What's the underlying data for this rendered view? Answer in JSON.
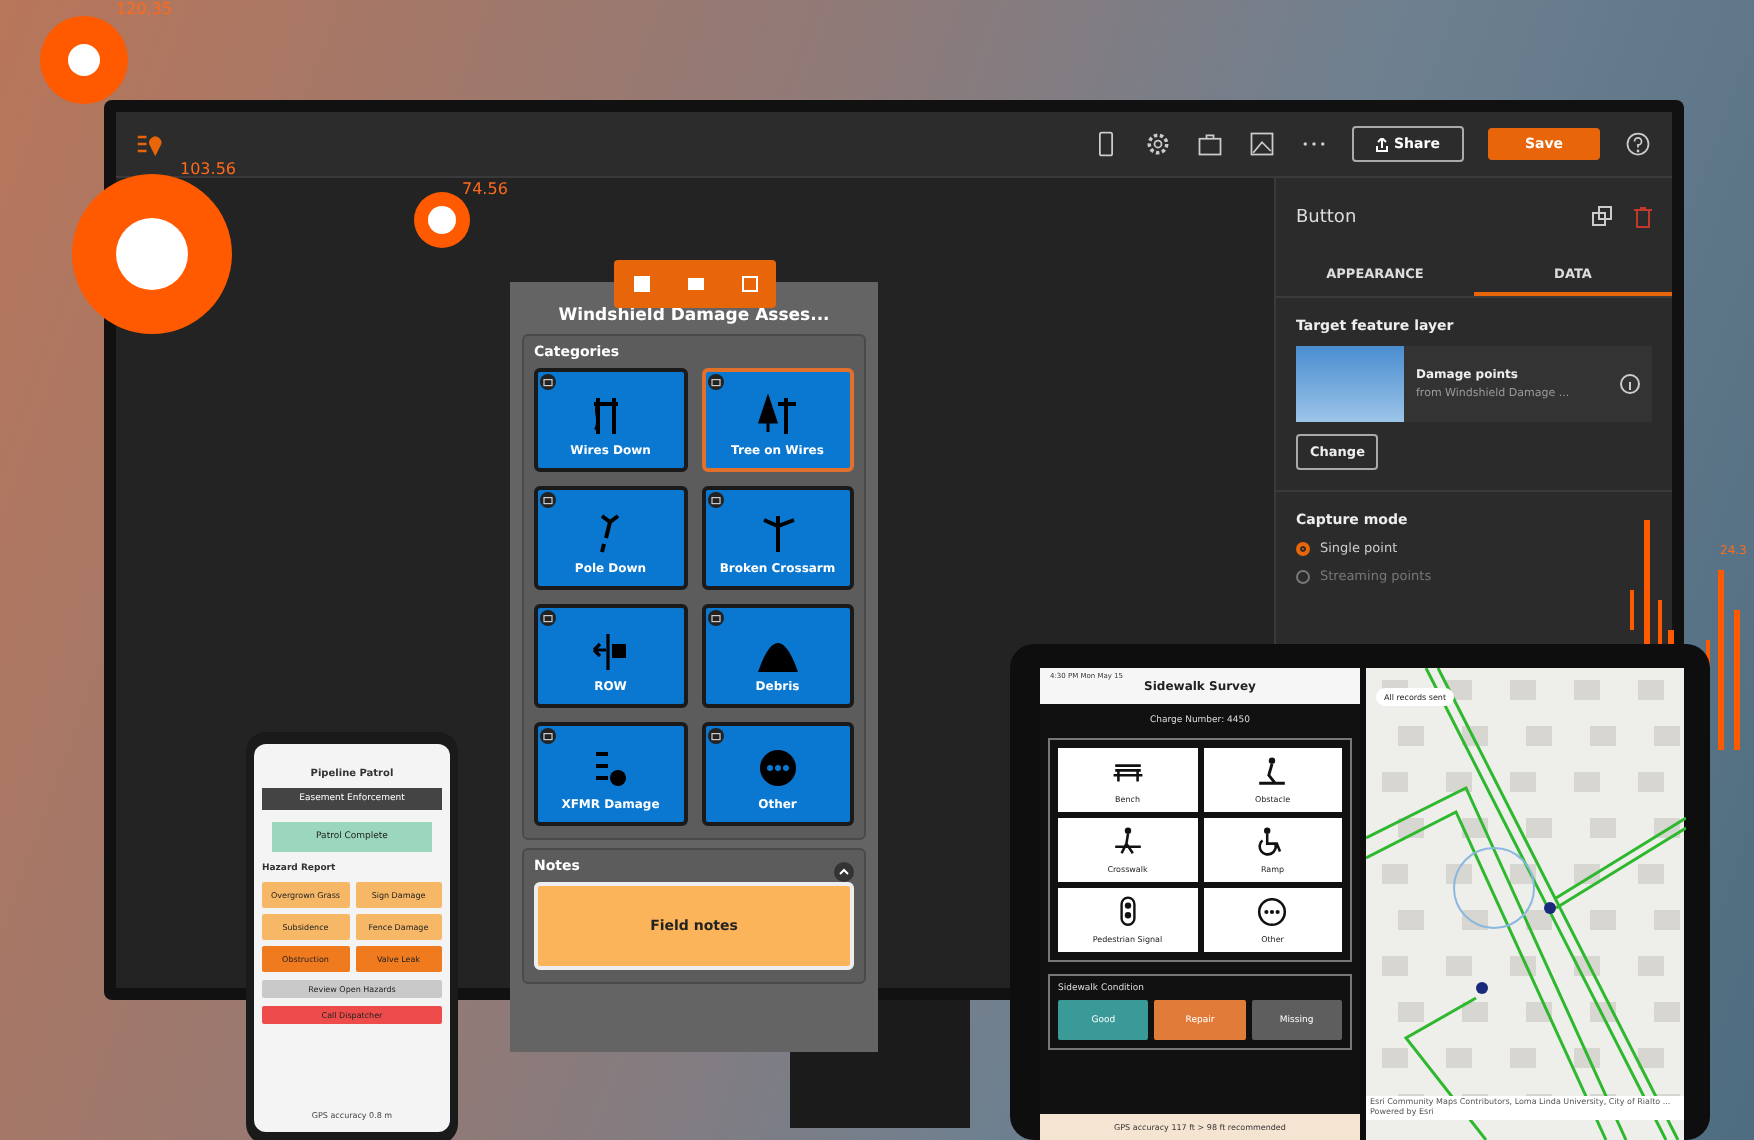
{
  "markers": [
    "120.35",
    "103.56",
    "74.56"
  ],
  "bar_label": "24.3",
  "builder": {
    "buttons": [
      {
        "label": "Share",
        "kind": "outline"
      },
      {
        "label": "Save",
        "kind": "primary"
      }
    ],
    "form": {
      "title": "Windshield Damage Asses...",
      "section": "Categories",
      "tiles": [
        {
          "label": "Wires Down",
          "selected": false
        },
        {
          "label": "Tree on Wires",
          "selected": true
        },
        {
          "label": "Pole Down",
          "selected": false
        },
        {
          "label": "Broken Crossarm",
          "selected": false
        },
        {
          "label": "ROW",
          "selected": false
        },
        {
          "label": "Debris",
          "selected": false
        },
        {
          "label": "XFMR Damage",
          "selected": false
        },
        {
          "label": "Other",
          "selected": false
        }
      ],
      "notes_label": "Notes",
      "notes_button": "Field notes"
    },
    "panel": {
      "title": "Button",
      "tabs": [
        {
          "label": "APPEARANCE",
          "selected": false
        },
        {
          "label": "DATA",
          "selected": true
        }
      ],
      "layer_heading": "Target feature layer",
      "layer_name": "Damage points",
      "layer_source": "from Windshield Damage ...",
      "change_button": "Change",
      "capture_heading": "Capture mode",
      "capture_options": [
        {
          "label": "Single point",
          "selected": true
        },
        {
          "label": "Streaming points",
          "selected": false
        }
      ]
    }
  },
  "phone": {
    "title": "Pipeline Patrol",
    "banner": "Easement Enforcement",
    "complete_button": "Patrol Complete",
    "section": "Hazard Report",
    "hazards": [
      {
        "label": "Overgrown Grass",
        "color": "#f6b867"
      },
      {
        "label": "Sign Damage",
        "color": "#f6b867"
      },
      {
        "label": "Subsidence",
        "color": "#f6b867"
      },
      {
        "label": "Fence Damage",
        "color": "#f6b867"
      },
      {
        "label": "Obstruction",
        "color": "#f07a1e"
      },
      {
        "label": "Valve Leak",
        "color": "#f07a1e"
      }
    ],
    "actions": [
      {
        "label": "Review Open Hazards",
        "color": "#c9c9c9"
      },
      {
        "label": "Call Dispatcher",
        "color": "#ee4b4b"
      }
    ],
    "status": "GPS accuracy 0.8 m"
  },
  "tablet": {
    "status_time": "4:30 PM  Mon May 15",
    "title": "Sidewalk Survey",
    "charge": "Charge Number: 4450",
    "features": [
      "Bench",
      "Obstacle",
      "Crosswalk",
      "Ramp",
      "Pedestrian Signal",
      "Other"
    ],
    "condition_heading": "Sidewalk Condition",
    "conditions": [
      {
        "label": "Good",
        "color": "#3a9a98"
      },
      {
        "label": "Repair",
        "color": "#e07b3a"
      },
      {
        "label": "Missing",
        "color": "#5e5e5e"
      }
    ],
    "warning": "GPS accuracy 117 ft > 98 ft recommended",
    "map_badge": "All records sent",
    "attribution": "Esri Community Maps Contributors, Loma Linda University, City of Rialto ... Powered by Esri"
  }
}
